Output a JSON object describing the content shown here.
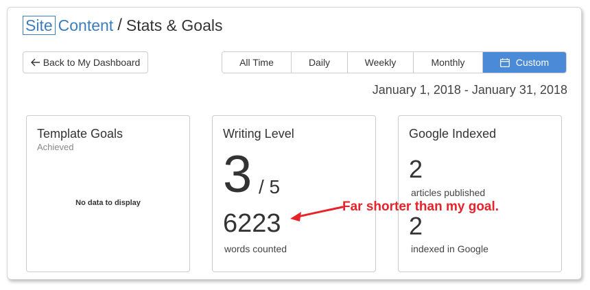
{
  "header": {
    "logo_part1": "Site",
    "logo_part2": "Content",
    "separator": "/",
    "page_title": "Stats & Goals"
  },
  "toolbar": {
    "back_label": "Back to My Dashboard",
    "back_icon": "arrow-left-icon",
    "ranges": [
      {
        "label": "All Time",
        "active": false
      },
      {
        "label": "Daily",
        "active": false
      },
      {
        "label": "Weekly",
        "active": false
      },
      {
        "label": "Monthly",
        "active": false
      },
      {
        "label": "Custom",
        "active": true,
        "icon": "calendar-icon"
      }
    ]
  },
  "date_range": {
    "start": "January 1, 2018",
    "sep": "-",
    "end": "January 31, 2018"
  },
  "cards": {
    "template_goals": {
      "title": "Template Goals",
      "subtitle": "Achieved",
      "empty_text": "No data to display"
    },
    "writing_level": {
      "title": "Writing Level",
      "level": "3",
      "of": "/ 5",
      "words": "6223",
      "words_label": "words counted"
    },
    "google_indexed": {
      "title": "Google Indexed",
      "articles": "2",
      "articles_label": "articles published",
      "indexed": "2",
      "indexed_label": "indexed in Google"
    }
  },
  "annotation": {
    "text": "Far shorter than my goal.",
    "color": "#e8222a"
  },
  "colors": {
    "accent": "#4a8ad6",
    "logo": "#3b7dbd"
  }
}
